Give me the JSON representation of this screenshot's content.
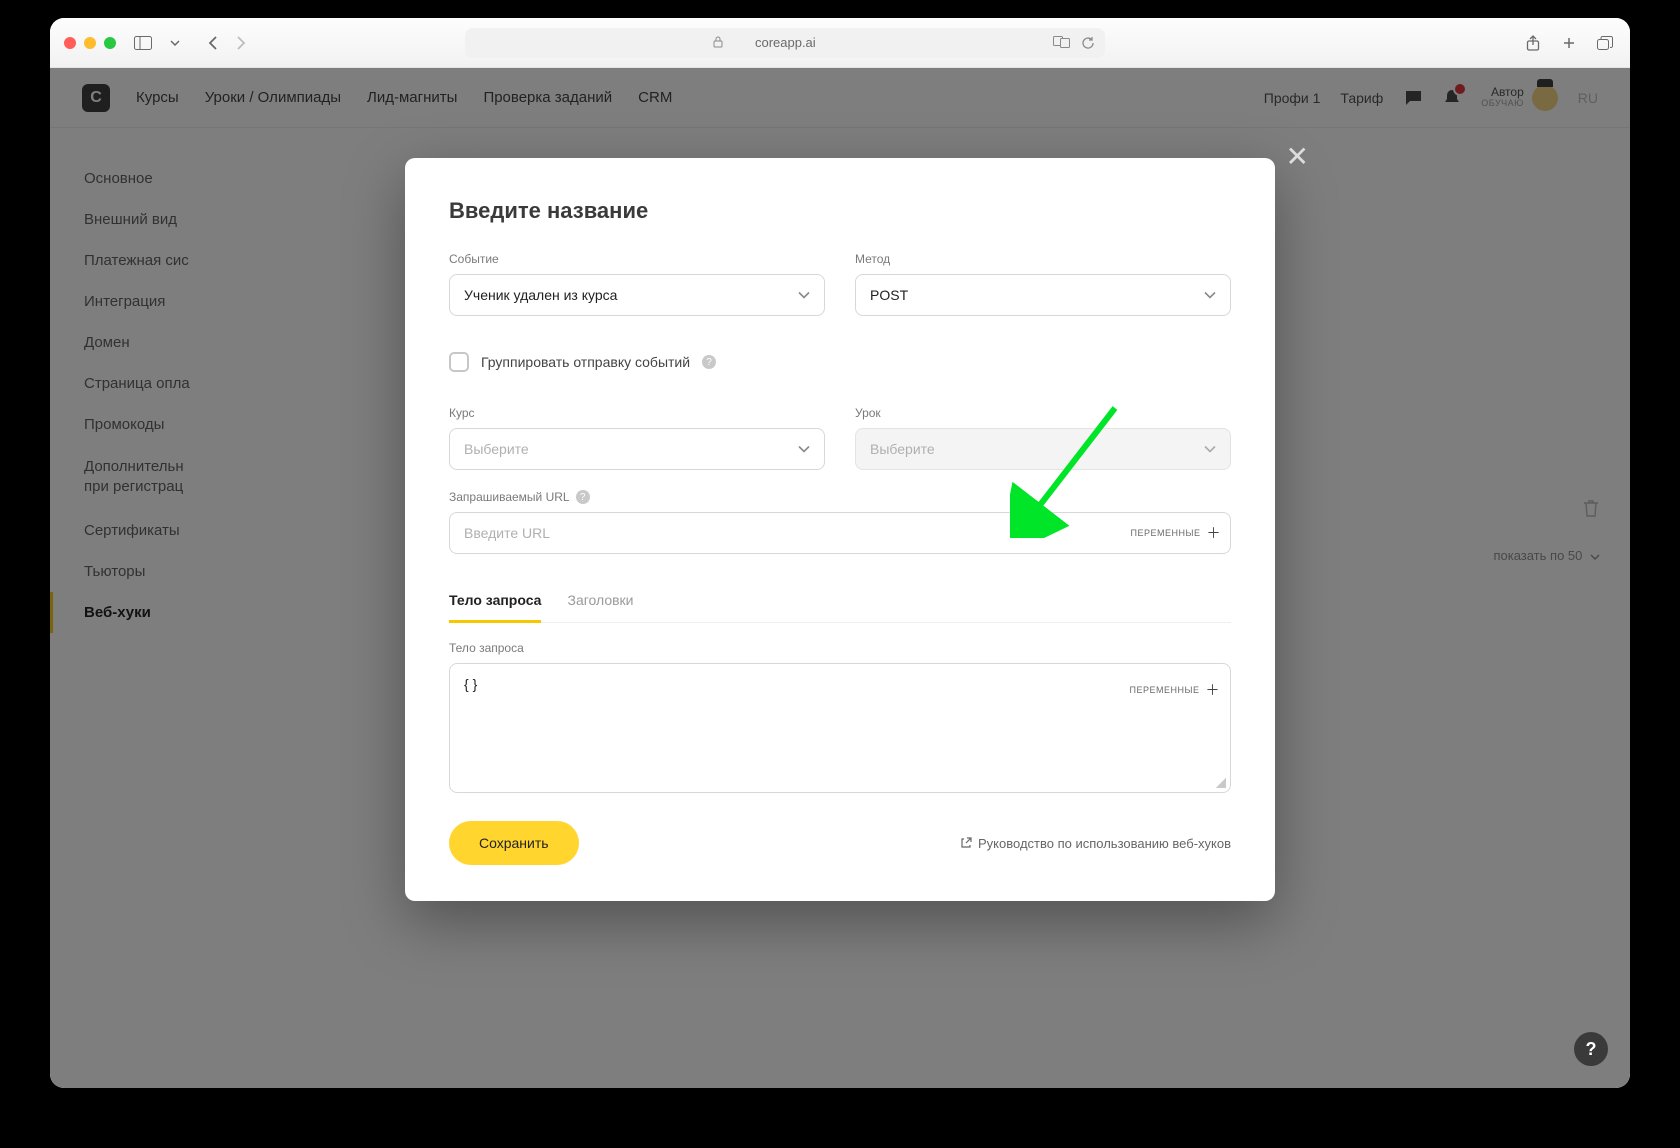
{
  "browser": {
    "url": "coreapp.ai"
  },
  "nav": {
    "items": [
      "Курсы",
      "Уроки / Олимпиады",
      "Лид-магниты",
      "Проверка заданий",
      "CRM"
    ],
    "plan": "Профи 1",
    "tariff": "Тариф",
    "user_name": "Автор",
    "user_sub": "ОБУЧАЮ",
    "lang": "RU"
  },
  "sidebar": {
    "items": [
      "Основное",
      "Внешний вид",
      "Платежная сис",
      "Интеграция",
      "Домен",
      "Страница опла",
      "Промокоды",
      "Дополнительн\nпри регистрац",
      "Сертификаты",
      "Тьюторы",
      "Веб-хуки"
    ],
    "active_index": 10
  },
  "content": {
    "show_per": "показать по 50"
  },
  "modal": {
    "title": "Введите название",
    "event_label": "Событие",
    "event_value": "Ученик удален из курса",
    "method_label": "Метод",
    "method_value": "POST",
    "group_label": "Группировать отправку событий",
    "course_label": "Курс",
    "course_placeholder": "Выберите",
    "lesson_label": "Урок",
    "lesson_placeholder": "Выберите",
    "url_label": "Запрашиваемый URL",
    "url_placeholder": "Введите URL",
    "vars_label": "ПЕРЕМЕННЫЕ",
    "tabs": {
      "body": "Тело запроса",
      "headers": "Заголовки"
    },
    "body_label": "Тело запроса",
    "body_value": "{ }",
    "save": "Сохранить",
    "guide": "Руководство по использованию веб-хуков"
  }
}
